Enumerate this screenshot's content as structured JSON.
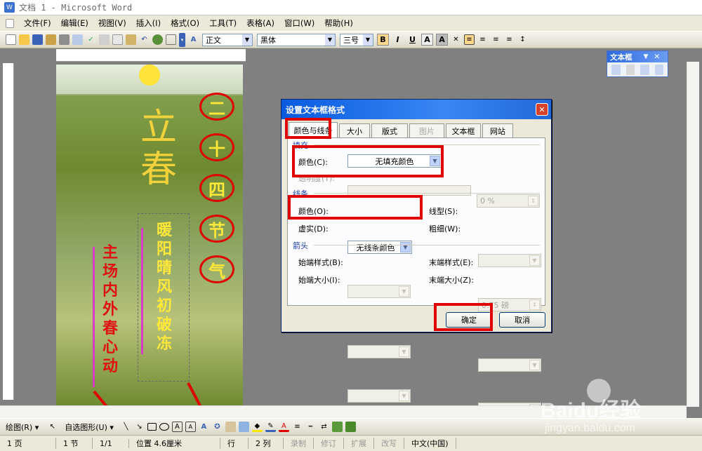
{
  "window": {
    "title": "文档 1 - Microsoft Word"
  },
  "menu": [
    "文件(F)",
    "编辑(E)",
    "视图(V)",
    "插入(I)",
    "格式(O)",
    "工具(T)",
    "表格(A)",
    "窗口(W)",
    "帮助(H)"
  ],
  "formatting": {
    "style": "正文",
    "font": "黑体",
    "size": "三号",
    "bold": "B",
    "italic": "I",
    "underline": "U",
    "char_border": "A",
    "char_shade": "A"
  },
  "textbox_toolbar": {
    "title": "文本框"
  },
  "page": {
    "title_chars": "立春",
    "circle_chars": [
      "二",
      "十",
      "四",
      "节",
      "气"
    ],
    "verse_left": "主场内外春心动",
    "verse_right": "暖阳晴风初破冻"
  },
  "dialog": {
    "title": "设置文本框格式",
    "close": "✕",
    "tabs": [
      "颜色与线条",
      "大小",
      "版式",
      "图片",
      "文本框",
      "网站"
    ],
    "fill_group": "填充",
    "fill_color_label": "颜色(C):",
    "fill_color_value": "无填充颜色",
    "transparency_label": "透明度(T):",
    "transparency_value": "0 %",
    "line_group": "线条",
    "line_color_label": "颜色(O):",
    "line_color_value": "无线条颜色",
    "line_style_label": "线型(S):",
    "dash_label": "虚实(D):",
    "weight_label": "粗细(W):",
    "weight_value": "0.75 磅",
    "arrow_group": "箭头",
    "begin_style_label": "始端样式(B):",
    "end_style_label": "末端样式(E):",
    "begin_size_label": "始端大小(I):",
    "end_size_label": "末端大小(Z):",
    "ok": "确定",
    "cancel": "取消"
  },
  "draw_toolbar": {
    "draw_label": "绘图(R) ▾",
    "autoshapes_label": "自选图形(U) ▾"
  },
  "status": {
    "page": "1 页",
    "section": "1 节",
    "pages": "1/1",
    "position": "位置 4.6厘米",
    "line": "行",
    "col": "2 列",
    "rec": "录制",
    "trk": "修订",
    "ext": "扩展",
    "ovr": "改写",
    "lang": "中文(中国)"
  },
  "watermark": {
    "brand": "Baidu经验",
    "url": "jingyan.baidu.com"
  }
}
